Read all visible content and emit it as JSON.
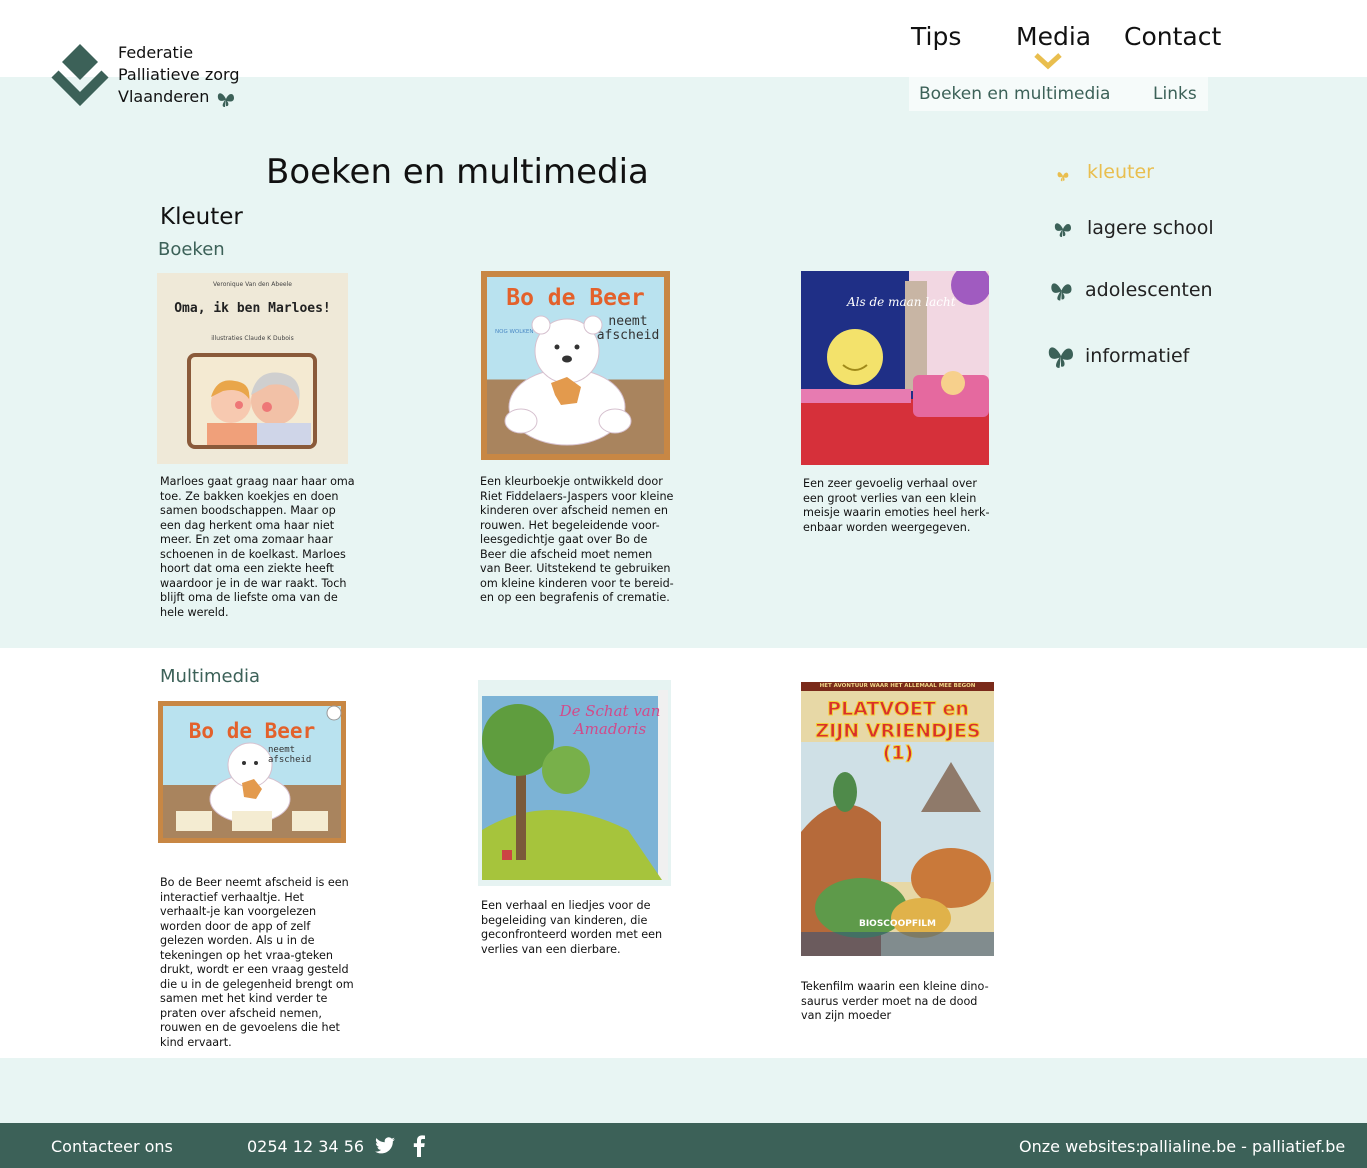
{
  "brand": {
    "line1": "Federatie",
    "line2": "Palliatieve zorg",
    "line3": "Vlaanderen"
  },
  "nav": {
    "tips": "Tips",
    "media": "Media",
    "contact": "Contact"
  },
  "subnav": {
    "books": "Boeken en multimedia",
    "links": "Links"
  },
  "page_title": "Boeken en multimedia",
  "section_title": "Kleuter",
  "books_heading": "Boeken",
  "multimedia_heading": "Multimedia",
  "sidebar": [
    {
      "label": "kleuter",
      "active": true
    },
    {
      "label": "lagere school",
      "active": false
    },
    {
      "label": "adolescenten",
      "active": false
    },
    {
      "label": "informatief",
      "active": false
    }
  ],
  "books": [
    {
      "cover_author": "Veronique Van den Abeele",
      "cover_title": "Oma, ik ben Marloes!",
      "cover_sub": "illustraties Claude K Dubois",
      "desc": "Marloes gaat graag naar haar oma toe. Ze bakken koekjes en doen samen boodschappen. Maar op een dag herkent oma haar niet meer. En zet oma zomaar haar schoenen in de koelkast. Marloes hoort dat oma een ziekte heeft waardoor je in de war raakt. Toch blijft oma de liefste oma van de hele wereld."
    },
    {
      "cover_title": "Bo de Beer",
      "cover_sub": "neemt afscheid",
      "cover_brand": "NOG WOLKEN",
      "desc": "Een kleurboekje ontwikkeld door Riet Fiddelaers-Jaspers voor kleine kinderen over afscheid nemen en rouwen. Het begeleidende voor-leesgedichtje gaat over Bo de Beer die afscheid moet nemen van Beer. Uitstekend te gebruiken om kleine kinderen voor te bereid-en op een begrafenis of crematie."
    },
    {
      "cover_title": "Als de maan lacht",
      "desc": "Een zeer gevoelig verhaal over een groot verlies van een klein meisje waarin emoties heel herk-enbaar worden weergegeven."
    }
  ],
  "multimedia": [
    {
      "cover_title": "Bo de Beer",
      "cover_sub": "neemt afscheid",
      "desc": "Bo de Beer neemt afscheid is een interactief verhaaltje. Het verhaalt-je kan voorgelezen worden door de app of zelf gelezen worden. Als u in de tekeningen op het vraa-gteken drukt, wordt er een vraag gesteld die u in de gelegenheid brengt om samen met het kind verder te praten over afscheid nemen, rouwen en de gevoelens die het kind ervaart."
    },
    {
      "cover_title": "De Schat van Amadoris",
      "desc": "Een verhaal en liedjes voor de begeleiding van kinderen, die geconfronteerd worden met een verlies van een dierbare."
    },
    {
      "cover_top": "HET AVONTUUR WAAR HET ALLEMAAL MEE BEGON",
      "cover_title": "PLATVOET en ZIJN VRIENDJES (1)",
      "cover_bottom": "BIOSCOOPFILM",
      "desc": "Tekenfilm waarin een kleine dino-saurus verder moet na de dood van zijn moeder"
    }
  ],
  "footer": {
    "contact": "Contacteer ons",
    "phone": "0254 12 34 56",
    "websites_label": "Onze websites:",
    "websites": "pallialine.be - palliatief.be"
  },
  "colors": {
    "mint": "#e8f5f3",
    "green": "#3c6158",
    "accent": "#e9be4e"
  }
}
